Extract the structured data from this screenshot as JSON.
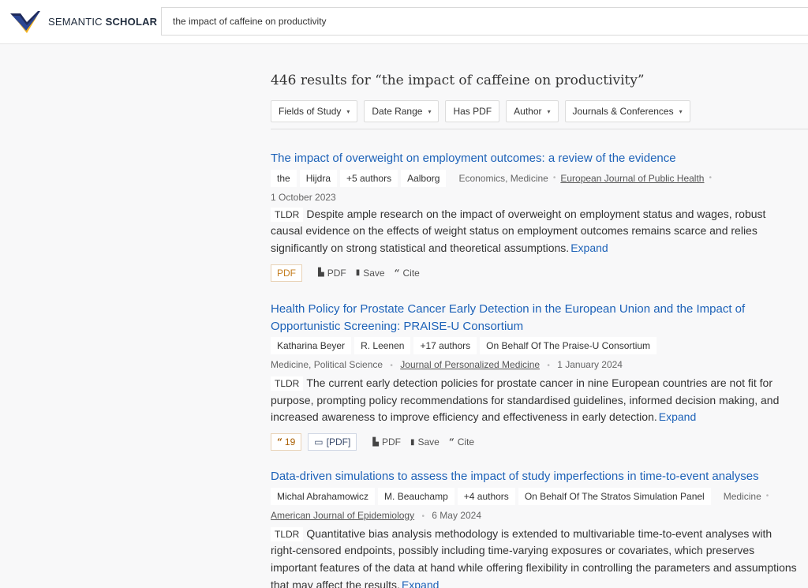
{
  "header": {
    "brand_left": "SEMANTIC ",
    "brand_bold": "SCHOLAR",
    "search_value": "the impact of caffeine on productivity"
  },
  "results": {
    "count_text": "446 results for “the impact of caffeine on productivity”"
  },
  "filters": [
    {
      "label": "Fields of Study"
    },
    {
      "label": "Date Range"
    },
    {
      "label": "Has PDF"
    },
    {
      "label": "Author"
    },
    {
      "label": "Journals & Conferences"
    }
  ],
  "papers": [
    {
      "title": "The impact of overweight on employment outcomes: a review of the evidence",
      "authors": [
        "the",
        "Hijdra",
        "+5 authors",
        "Aalborg"
      ],
      "fields": "Economics, Medicine",
      "venue": "European Journal of Public Health",
      "date": "1 October 2023",
      "tldr_label": "TLDR",
      "tldr": "Despite ample research on the impact of overweight on employment status and wages, robust causal evidence on the effects of weight status on employment outcomes remains scarce and relies significantly on strong statistical and theoretical assumptions.",
      "expand": "Expand",
      "pdf_box": "PDF",
      "pdf": "PDF",
      "save": "Save",
      "cite": "Cite"
    },
    {
      "title": "Health Policy for Prostate Cancer Early Detection in the European Union and the Impact of Opportunistic Screening: PRAISE-U Consortium",
      "authors": [
        "Katharina Beyer",
        "R. Leenen",
        "+17 authors",
        "On Behalf Of The Praise-U Consortium"
      ],
      "fields": "Medicine, Political Science",
      "venue": "Journal of Personalized Medicine",
      "date": "1 January 2024",
      "tldr_label": "TLDR",
      "tldr": "The current early detection policies for prostate cancer in nine European countries are not fit for purpose, prompting policy recommendations for standardised guidelines, informed decision making, and increased awareness to improve efficiency and effectiveness in early detection.",
      "expand": "Expand",
      "citations": "19",
      "pdf_source": "[PDF]",
      "pdf": "PDF",
      "save": "Save",
      "cite": "Cite"
    },
    {
      "title": "Data-driven simulations to assess the impact of study imperfections in time-to-event analyses",
      "authors": [
        "Michal Abrahamowicz",
        "M. Beauchamp",
        "+4 authors",
        "On Behalf Of The Stratos Simulation Panel"
      ],
      "fields": "Medicine",
      "venue": "American Journal of Epidemiology",
      "date": "6 May 2024",
      "tldr_label": "TLDR",
      "tldr": "Quantitative bias analysis methodology is extended to multivariable time-to-event analyses with right-censored endpoints, possibly including time-varying exposures or covariates, which preserves important features of the data at hand while offering flexibility in controlling the parameters and assumptions that may affect the results.",
      "expand": "Expand"
    }
  ]
}
